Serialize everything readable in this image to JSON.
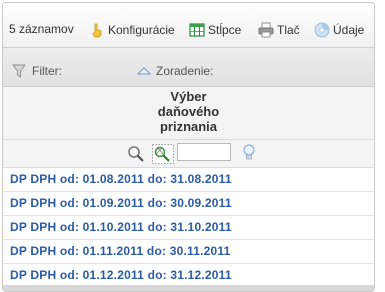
{
  "toolbar": {
    "record_count": "5 záznamov",
    "config_label": "Konfigurácie",
    "columns_label": "Stĺpce",
    "print_label": "Tlač",
    "data_label": "Údaje"
  },
  "filterbar": {
    "filter_label": "Filter:",
    "sort_label": "Zoradenie:"
  },
  "table": {
    "column_header": [
      "Výber",
      "daňového",
      "priznania"
    ],
    "search_value": "",
    "rows": [
      "DP DPH od: 01.08.2011 do: 31.08.2011",
      "DP DPH od: 01.09.2011 do: 30.09.2011",
      "DP DPH od: 01.10.2011 do: 31.10.2011",
      "DP DPH od: 01.11.2011 do: 30.11.2011",
      "DP DPH od: 01.12.2011 do: 31.12.2011"
    ]
  },
  "icons": {
    "config": "hand-pointer-icon",
    "columns": "columns-table-icon",
    "print": "printer-icon",
    "data": "data-disc-icon",
    "filter": "funnel-icon",
    "sort": "sort-triangle-icon",
    "search": "magnifier-icon",
    "clear_search": "magnifier-clear-icon",
    "hint": "lightbulb-icon"
  },
  "colors": {
    "link_blue": "#2a5aa8",
    "toolbar_bg": "#f0f0f0"
  }
}
